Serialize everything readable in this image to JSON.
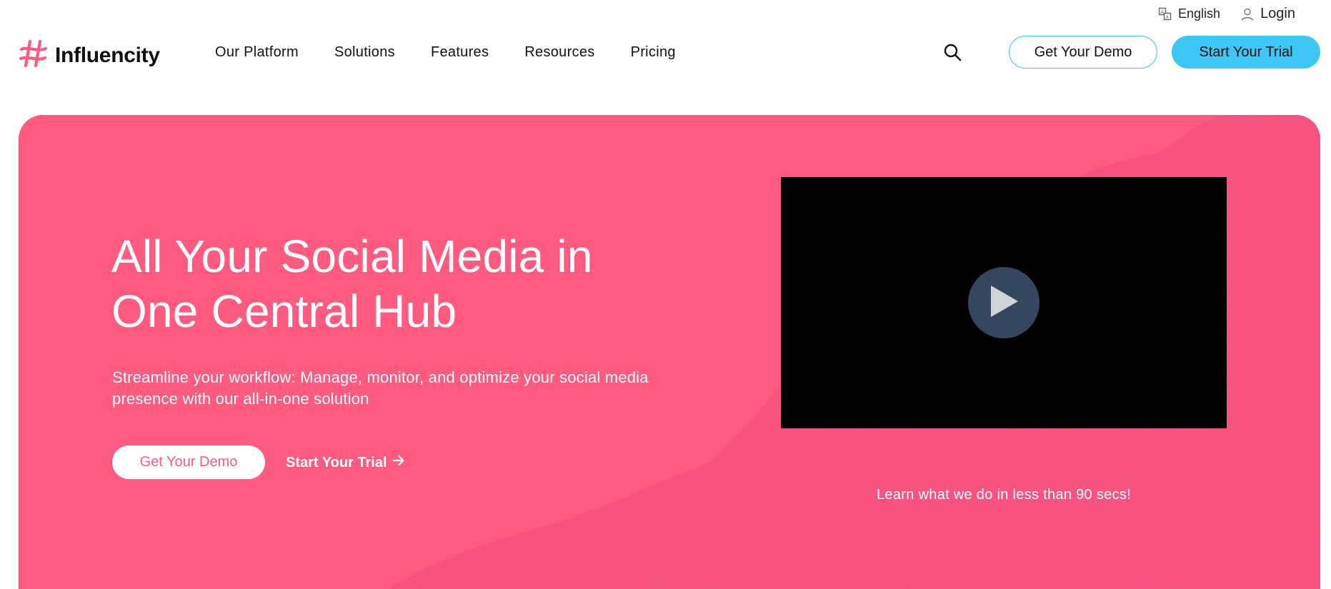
{
  "topbar": {
    "language_label": "English",
    "login_label": "Login",
    "language_icon": "translate-icon",
    "login_icon": "user-icon"
  },
  "brand": {
    "name": "Influencity",
    "logo_icon": "hashtag-logo-icon",
    "accent_color": "#ff5a80"
  },
  "nav": {
    "items": [
      {
        "label": "Our Platform"
      },
      {
        "label": "Solutions"
      },
      {
        "label": "Features"
      },
      {
        "label": "Resources"
      },
      {
        "label": "Pricing"
      }
    ],
    "search_icon": "search-icon",
    "demo_button": "Get Your Demo",
    "trial_button": "Start Your Trial",
    "button_color": "#3ec7f5"
  },
  "hero": {
    "title": "All Your Social Media in One Central Hub",
    "subtitle": "Streamline your workflow: Manage, monitor, and optimize your social media presence with our all-in-one solution",
    "demo_button": "Get Your Demo",
    "trial_link": "Start Your Trial",
    "trial_icon": "arrow-right-icon",
    "background_color": "#ff5a80",
    "video_caption": "Learn what we do in less than 90 secs!",
    "play_icon": "play-icon"
  }
}
